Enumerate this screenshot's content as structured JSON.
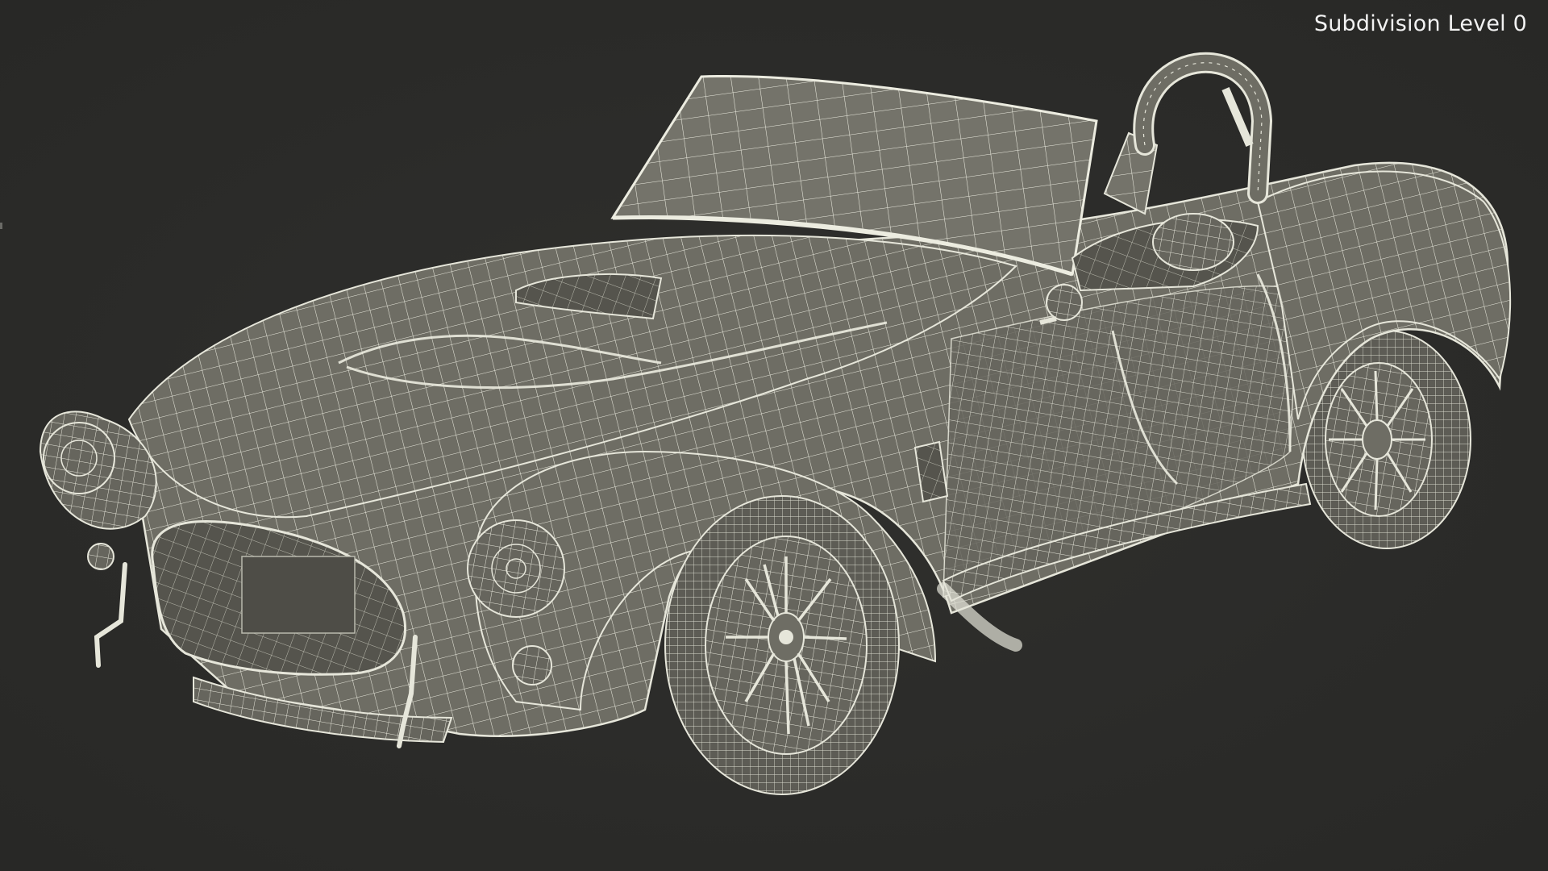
{
  "viewport": {
    "subdivision_label": "Subdivision Level 0"
  },
  "model": {
    "subject": "sports-roadster-wireframe",
    "colors": {
      "background": "#2b2b29",
      "surface": "#6e6d64",
      "surface_dark": "#55544d",
      "wire": "#e6e6da",
      "wire_dim": "#b9b9ad"
    }
  }
}
